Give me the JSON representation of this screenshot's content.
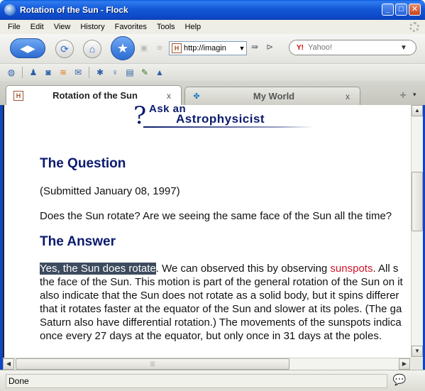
{
  "window": {
    "title": "Rotation of the Sun - Flock",
    "minimize": "_",
    "maximize": "□",
    "close": "✕"
  },
  "menu": {
    "items": [
      {
        "label": "File",
        "accel": "F"
      },
      {
        "label": "Edit",
        "accel": "E"
      },
      {
        "label": "View",
        "accel": "V"
      },
      {
        "label": "History",
        "accel": "s"
      },
      {
        "label": "Favorites",
        "accel": "a"
      },
      {
        "label": "Tools",
        "accel": "T"
      },
      {
        "label": "Help",
        "accel": "H"
      }
    ]
  },
  "toolbar": {
    "url": "http://imagin",
    "search_engine": "Y!",
    "search_placeholder": "Yahoo!"
  },
  "tabs": [
    {
      "label": "Rotation of the Sun",
      "active": true,
      "close": "x"
    },
    {
      "label": "My World",
      "active": false,
      "close": "x"
    }
  ],
  "page": {
    "logo_line1": "Ask an",
    "logo_line2": "Astrophysicist",
    "logo_mark": "?",
    "question_heading": "The Question",
    "submitted": "(Submitted January 08, 1997)",
    "question": "Does the Sun rotate? Are we seeing the same face of the Sun all the time?",
    "answer_heading": "The Answer",
    "answer_highlight": "Yes, the Sun does rotate",
    "answer_line1_mid": ". We can observed this by observing ",
    "answer_link": "sunspots",
    "answer_line1_end": ". All s",
    "answer_lines": [
      "the face of the Sun. This motion is part of the general rotation of the Sun on it",
      "also indicate that the Sun does not rotate as a solid body, but it spins differer",
      "that it rotates faster at the equator of the Sun and slower at its poles. (The ga",
      "Saturn also have differential rotation.) The movements of the sunspots indica",
      "once every 27 days at the equator, but only once in 31 days at the poles."
    ]
  },
  "status": {
    "text": "Done"
  },
  "colors": {
    "heading": "#0b1a6e",
    "link": "#d2142d",
    "selection": "#3d4b5e",
    "titlebar": "#0c47c6"
  }
}
